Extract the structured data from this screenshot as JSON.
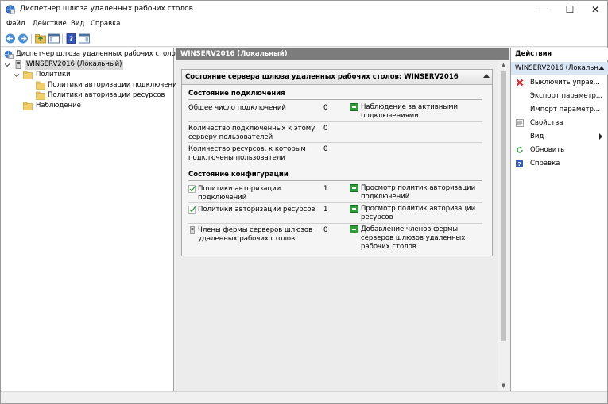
{
  "window": {
    "title": "Диспетчер шлюза удаленных рабочих столов",
    "controls": {
      "minimize": "—",
      "maximize": "☐",
      "close": "✕"
    }
  },
  "menu": [
    "Файл",
    "Действие",
    "Вид",
    "Справка"
  ],
  "toolbar": {
    "icons": [
      "back-arrow-icon",
      "forward-arrow-icon",
      "up-folder-icon",
      "show-hide-tree-icon",
      "help-icon",
      "show-hide-action-pane-icon"
    ]
  },
  "tree": {
    "root": "Диспетчер шлюза удаленных рабочих столов",
    "server": "WINSERV2016 (Локальный)",
    "policies": "Политики",
    "conn_policies": "Политики авторизации подключений",
    "res_policies": "Политики авторизации ресурсов",
    "monitoring": "Наблюдение"
  },
  "center": {
    "header": "WINSERV2016 (Локальный)",
    "panel_title": "Состояние сервера шлюза удаленных рабочих столов: WINSERV2016",
    "connection_section": "Состояние подключения",
    "connection_rows": [
      {
        "label": "Общее число подключений",
        "value": "0",
        "action": "Наблюдение за активными подключениями"
      },
      {
        "label": "Количество подключенных к этому серверу пользователей",
        "value": "0",
        "action": ""
      },
      {
        "label": "Количество ресурсов, к которым подключены пользователи",
        "value": "0",
        "action": ""
      }
    ],
    "config_section": "Состояние конфигурации",
    "config_rows": [
      {
        "label": "Политики авторизации подключений",
        "value": "1",
        "action": "Просмотр политик авторизации подключений"
      },
      {
        "label": "Политики авторизации ресурсов",
        "value": "1",
        "action": "Просмотр политик авторизации ресурсов"
      },
      {
        "label": "Члены фермы серверов шлюзов удаленных рабочих столов",
        "value": "0",
        "action": "Добавление членов фермы серверов шлюзов удаленных рабочих столов"
      }
    ]
  },
  "actions": {
    "header": "Действия",
    "sub_header": "WINSERV2016 (Локальн...",
    "items": [
      {
        "label": "Выключить управ...",
        "icon": "red-x-icon"
      },
      {
        "label": "Экспорт параметр...",
        "icon": ""
      },
      {
        "label": "Импорт параметр...",
        "icon": ""
      },
      {
        "label": "Свойства",
        "icon": "properties-icon"
      },
      {
        "label": "Вид",
        "icon": ""
      },
      {
        "label": "Обновить",
        "icon": "refresh-icon"
      },
      {
        "label": "Справка",
        "icon": "help-icon"
      }
    ]
  },
  "colors": {
    "center_header_bg": "#7c7c7c",
    "selected_action_bg": "#d9e6f5",
    "action_link_green": "#2e9e3a"
  }
}
